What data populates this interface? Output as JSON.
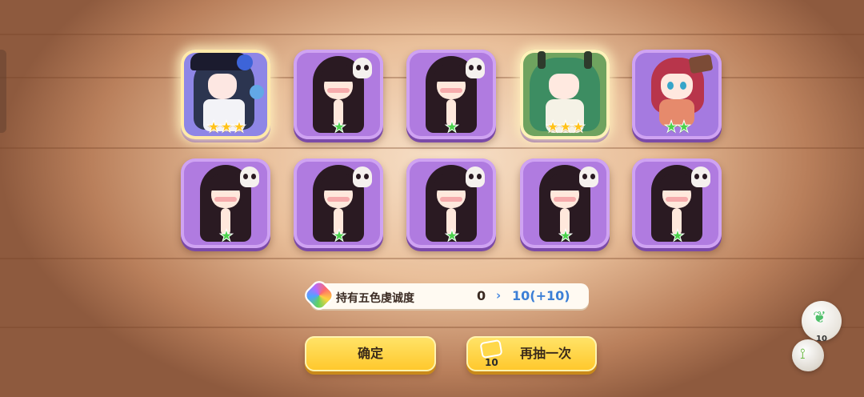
{
  "results": {
    "row1": [
      {
        "type": "gold-character-1",
        "stars": 3,
        "star_color": "gold"
      },
      {
        "type": "dark-hair-skull",
        "stars": 1,
        "star_color": "green"
      },
      {
        "type": "dark-hair-skull",
        "stars": 1,
        "star_color": "green"
      },
      {
        "type": "gold-character-2",
        "stars": 3,
        "star_color": "gold"
      },
      {
        "type": "red-hair",
        "stars": 2,
        "star_color": "green"
      }
    ],
    "row2": [
      {
        "type": "dark-hair-skull",
        "stars": 1,
        "star_color": "green"
      },
      {
        "type": "dark-hair-skull",
        "stars": 1,
        "star_color": "green"
      },
      {
        "type": "dark-hair-skull",
        "stars": 1,
        "star_color": "green"
      },
      {
        "type": "dark-hair-skull",
        "stars": 1,
        "star_color": "green"
      },
      {
        "type": "dark-hair-skull",
        "stars": 1,
        "star_color": "green"
      }
    ]
  },
  "stars": {
    "gold3": "★★★",
    "green1": "★",
    "green2": "★★"
  },
  "devotion_bar": {
    "label": "持有五色虔诚度",
    "from": "0",
    "arrow": "›",
    "to": "10(+10)"
  },
  "buttons": {
    "confirm": "确定",
    "draw_again": "再抽一次",
    "ticket_count": "10"
  },
  "side_items": {
    "bubble_count": "10",
    "leaf_icon": "leaf-icon",
    "node_icon": "node-icon"
  },
  "colors": {
    "card_purple": "#b07be0",
    "button_yellow": "#ffc72a",
    "highlight_blue": "#3c7fd6"
  }
}
